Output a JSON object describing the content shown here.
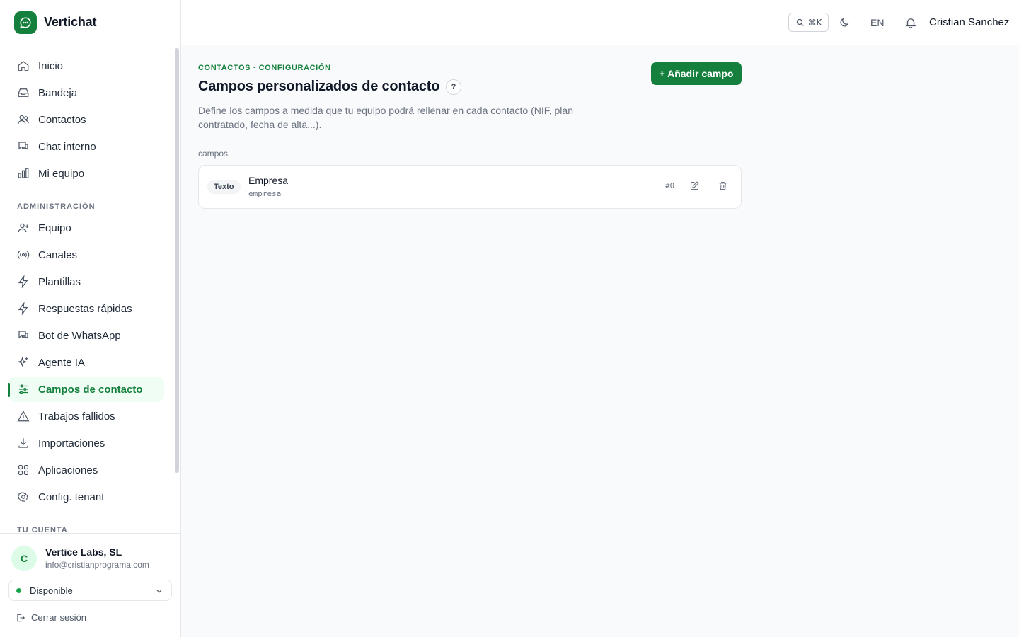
{
  "app": {
    "name": "Vertichat"
  },
  "sidebar": {
    "items": [
      {
        "label": "Inicio",
        "icon": "home-icon"
      },
      {
        "label": "Bandeja",
        "icon": "inbox-icon"
      },
      {
        "label": "Contactos",
        "icon": "users-icon"
      },
      {
        "label": "Chat interno",
        "icon": "chat-icon"
      },
      {
        "label": "Mi equipo",
        "icon": "bar-chart-icon"
      }
    ],
    "admin_title": "ADMINISTRACIÓN",
    "admin_items": [
      {
        "label": "Equipo",
        "icon": "user-plus-icon"
      },
      {
        "label": "Canales",
        "icon": "radio-icon"
      },
      {
        "label": "Plantillas",
        "icon": "bolt-icon"
      },
      {
        "label": "Respuestas rápidas",
        "icon": "bolt-icon"
      },
      {
        "label": "Bot de WhatsApp",
        "icon": "chat-icon"
      },
      {
        "label": "Agente IA",
        "icon": "sparkles-icon"
      },
      {
        "label": "Campos de contacto",
        "icon": "sliders-icon",
        "active": true
      },
      {
        "label": "Trabajos fallidos",
        "icon": "warning-icon"
      },
      {
        "label": "Importaciones",
        "icon": "download-icon"
      },
      {
        "label": "Aplicaciones",
        "icon": "grid-icon"
      },
      {
        "label": "Config. tenant",
        "icon": "gear-icon"
      }
    ],
    "account_title": "TU CUENTA"
  },
  "account": {
    "avatar_letter": "C",
    "name": "Vertice Labs, SL",
    "email": "info@cristianprograma.com",
    "status": "Disponible",
    "logout": "Cerrar sesión"
  },
  "header": {
    "search_shortcut": "⌘K",
    "language": "EN",
    "user_name": "Cristian Sanchez"
  },
  "page": {
    "breadcrumb": "CONTACTOS · CONFIGURACIÓN",
    "title": "Campos personalizados de contacto",
    "help": "?",
    "description": "Define los campos a medida que tu equipo podrá rellenar en cada contacto (NIF, plan contratado, fecha de alta...).",
    "add_button": "+ Añadir campo",
    "list_label": "campos"
  },
  "fields": [
    {
      "type": "Texto",
      "name": "Empresa",
      "key": "empresa",
      "order": "#0"
    }
  ],
  "colors": {
    "accent": "#15803d",
    "accent_bg": "#f0fdf4"
  }
}
